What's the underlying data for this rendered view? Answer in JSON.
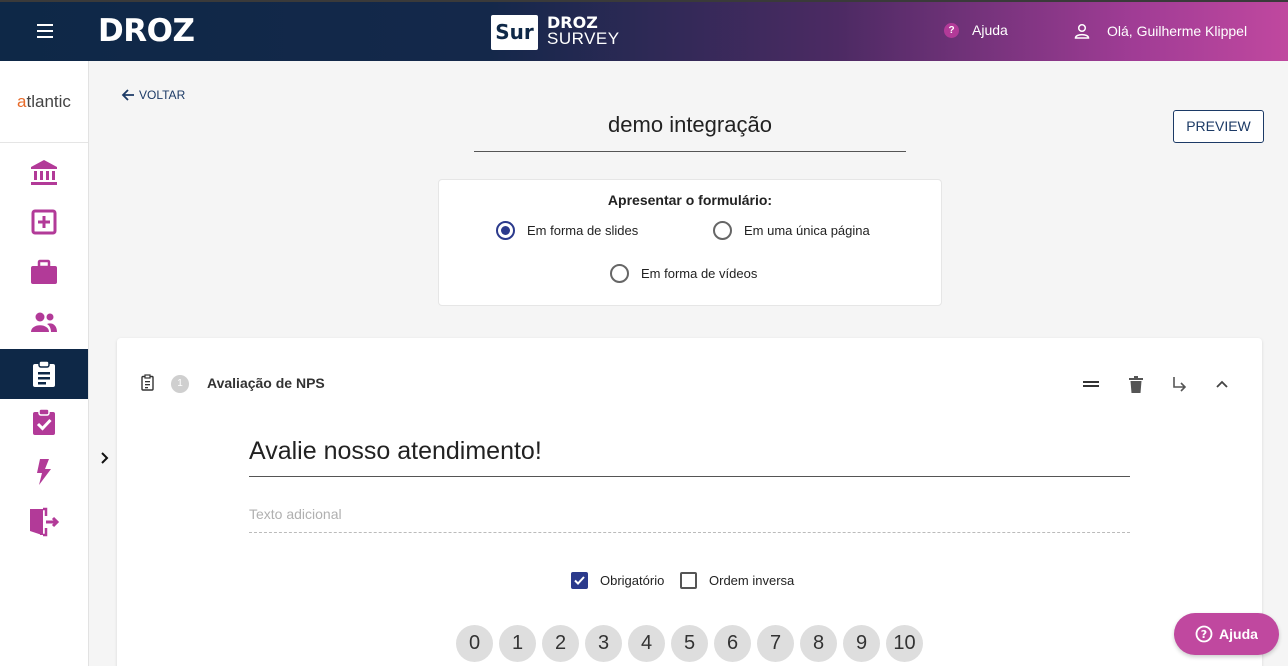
{
  "header": {
    "brand": "DROZ",
    "survey_badge": "Sur",
    "survey_title_1": "DROZ",
    "survey_title_2": "SURVEY",
    "help_label": "Ajuda",
    "user_greeting": "Olá, Guilherme Klippel"
  },
  "sidebar": {
    "brand_first": "a",
    "brand_rest": "tlantic",
    "items": [
      {
        "icon": "bank-icon"
      },
      {
        "icon": "add-box-icon"
      },
      {
        "icon": "briefcase-icon"
      },
      {
        "icon": "people-icon"
      },
      {
        "icon": "clipboard-icon",
        "active": true
      },
      {
        "icon": "assignment-check-icon"
      },
      {
        "icon": "lightning-icon"
      },
      {
        "icon": "exit-door-icon"
      }
    ]
  },
  "main": {
    "back_label": "VOLTAR",
    "survey_name": "demo integração",
    "preview_label": "PREVIEW",
    "present": {
      "title": "Apresentar o formulário:",
      "options": [
        "Em forma de slides",
        "Em uma única página",
        "Em forma de vídeos"
      ],
      "selected": "Em forma de slides"
    },
    "question": {
      "number": "1",
      "type_label": "Avaliação de NPS",
      "title": "Avalie nosso atendimento!",
      "extra_placeholder": "Texto adicional",
      "required_label": "Obrigatório",
      "required_checked": true,
      "reverse_label": "Ordem inversa",
      "reverse_checked": false,
      "scale": [
        "0",
        "1",
        "2",
        "3",
        "4",
        "5",
        "6",
        "7",
        "8",
        "9",
        "10"
      ]
    }
  },
  "help_fab_label": "Ajuda",
  "colors": {
    "primary": "#0e2847",
    "accent": "#b23a98",
    "radio": "#2b3a8c"
  }
}
